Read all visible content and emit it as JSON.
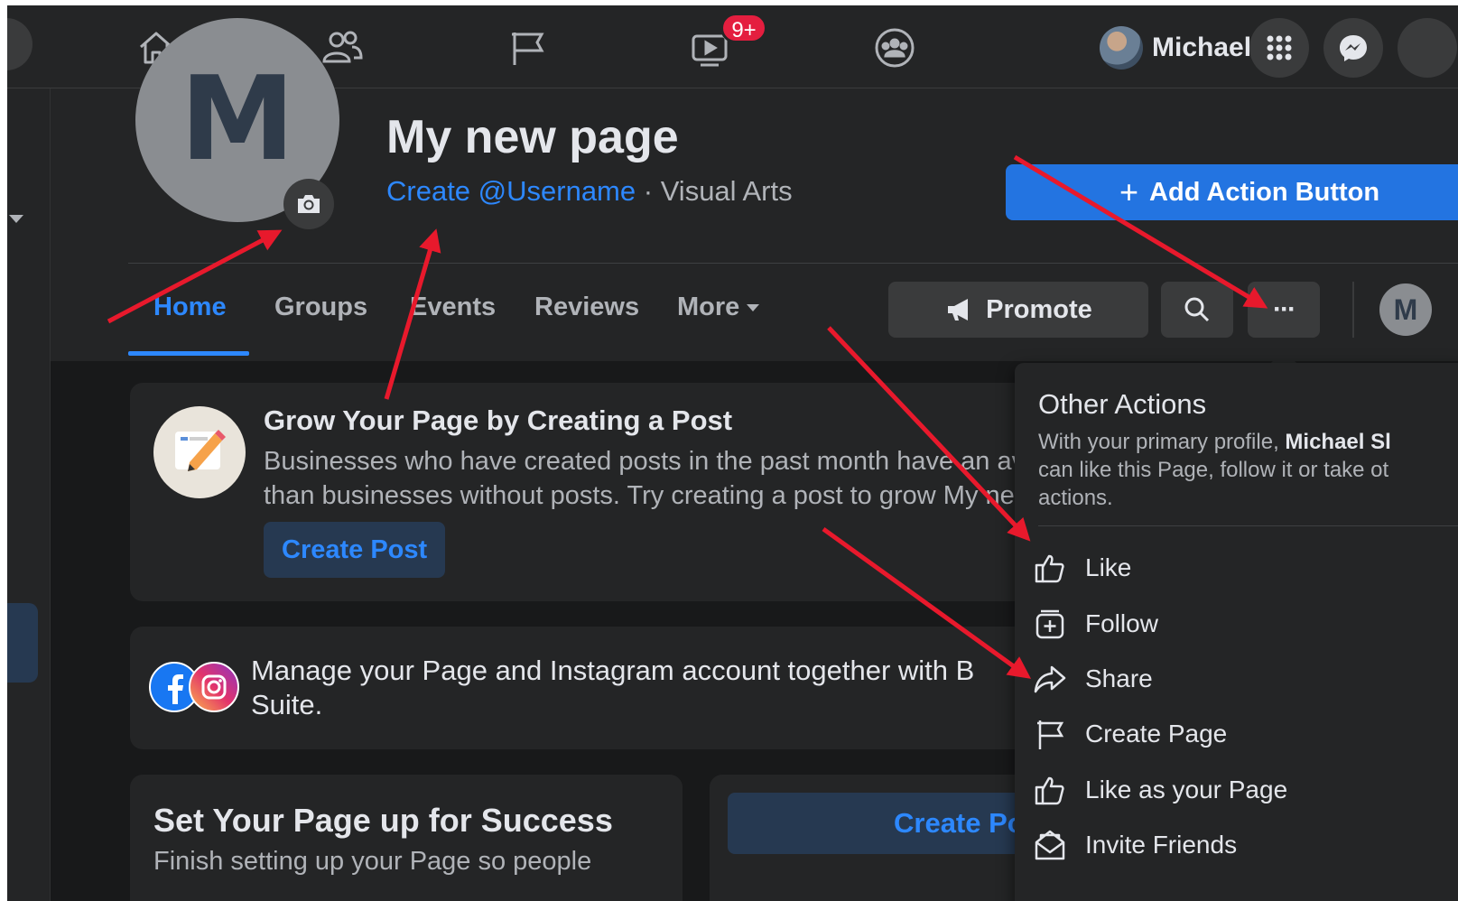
{
  "topbar": {
    "watch_badge": "9+",
    "profile_name": "Michael",
    "icons": [
      "home-icon",
      "friends-icon",
      "pages-flag-icon",
      "watch-icon",
      "groups-icon",
      "menu-grid-icon",
      "messenger-icon"
    ]
  },
  "page": {
    "avatar_letter": "M",
    "title": "My new page",
    "username_link": "Create @Username",
    "separator": " · ",
    "category": "Visual Arts",
    "add_action_label": "Add Action Button",
    "add_action_plus": "+"
  },
  "tabs": {
    "home": "Home",
    "groups": "Groups",
    "events": "Events",
    "reviews": "Reviews",
    "more": "More"
  },
  "header_buttons": {
    "promote": "Promote",
    "more_dots": "···",
    "mini_avatar_letter": "M"
  },
  "cards": {
    "grow": {
      "title": "Grow Your Page by Creating a Post",
      "line1": "Businesses who have created posts in the past month have an ave",
      "line2": "than businesses without posts. Try creating a post to grow My nev",
      "button": "Create Post"
    },
    "instagram": {
      "line1": "Manage your Page and Instagram account together with B",
      "line2": "Suite."
    },
    "setup": {
      "title": "Set Your Page up for Success",
      "subtitle": "Finish setting up your Page so people"
    },
    "create2": {
      "button": "Create Po"
    }
  },
  "dropdown": {
    "title": "Other Actions",
    "desc_before": "With your primary profile, ",
    "desc_bold": "Michael Sl",
    "desc_line2": "can like this Page, follow it or take ot",
    "desc_line3": "actions.",
    "items": [
      {
        "label": "Like",
        "icon": "thumbs-up-icon"
      },
      {
        "label": "Follow",
        "icon": "follow-plus-icon"
      },
      {
        "label": "Share",
        "icon": "share-arrow-icon"
      },
      {
        "label": "Create Page",
        "icon": "flag-icon"
      },
      {
        "label": "Like as your Page",
        "icon": "thumbs-up-icon"
      },
      {
        "label": "Invite Friends",
        "icon": "invite-envelope-icon"
      }
    ]
  },
  "colors": {
    "background": "#18191a",
    "surface": "#242526",
    "accent_blue": "#2d88ff",
    "button_blue": "#2374e1",
    "badge_red": "#e41e3f",
    "annotation_red": "#e8192c"
  }
}
